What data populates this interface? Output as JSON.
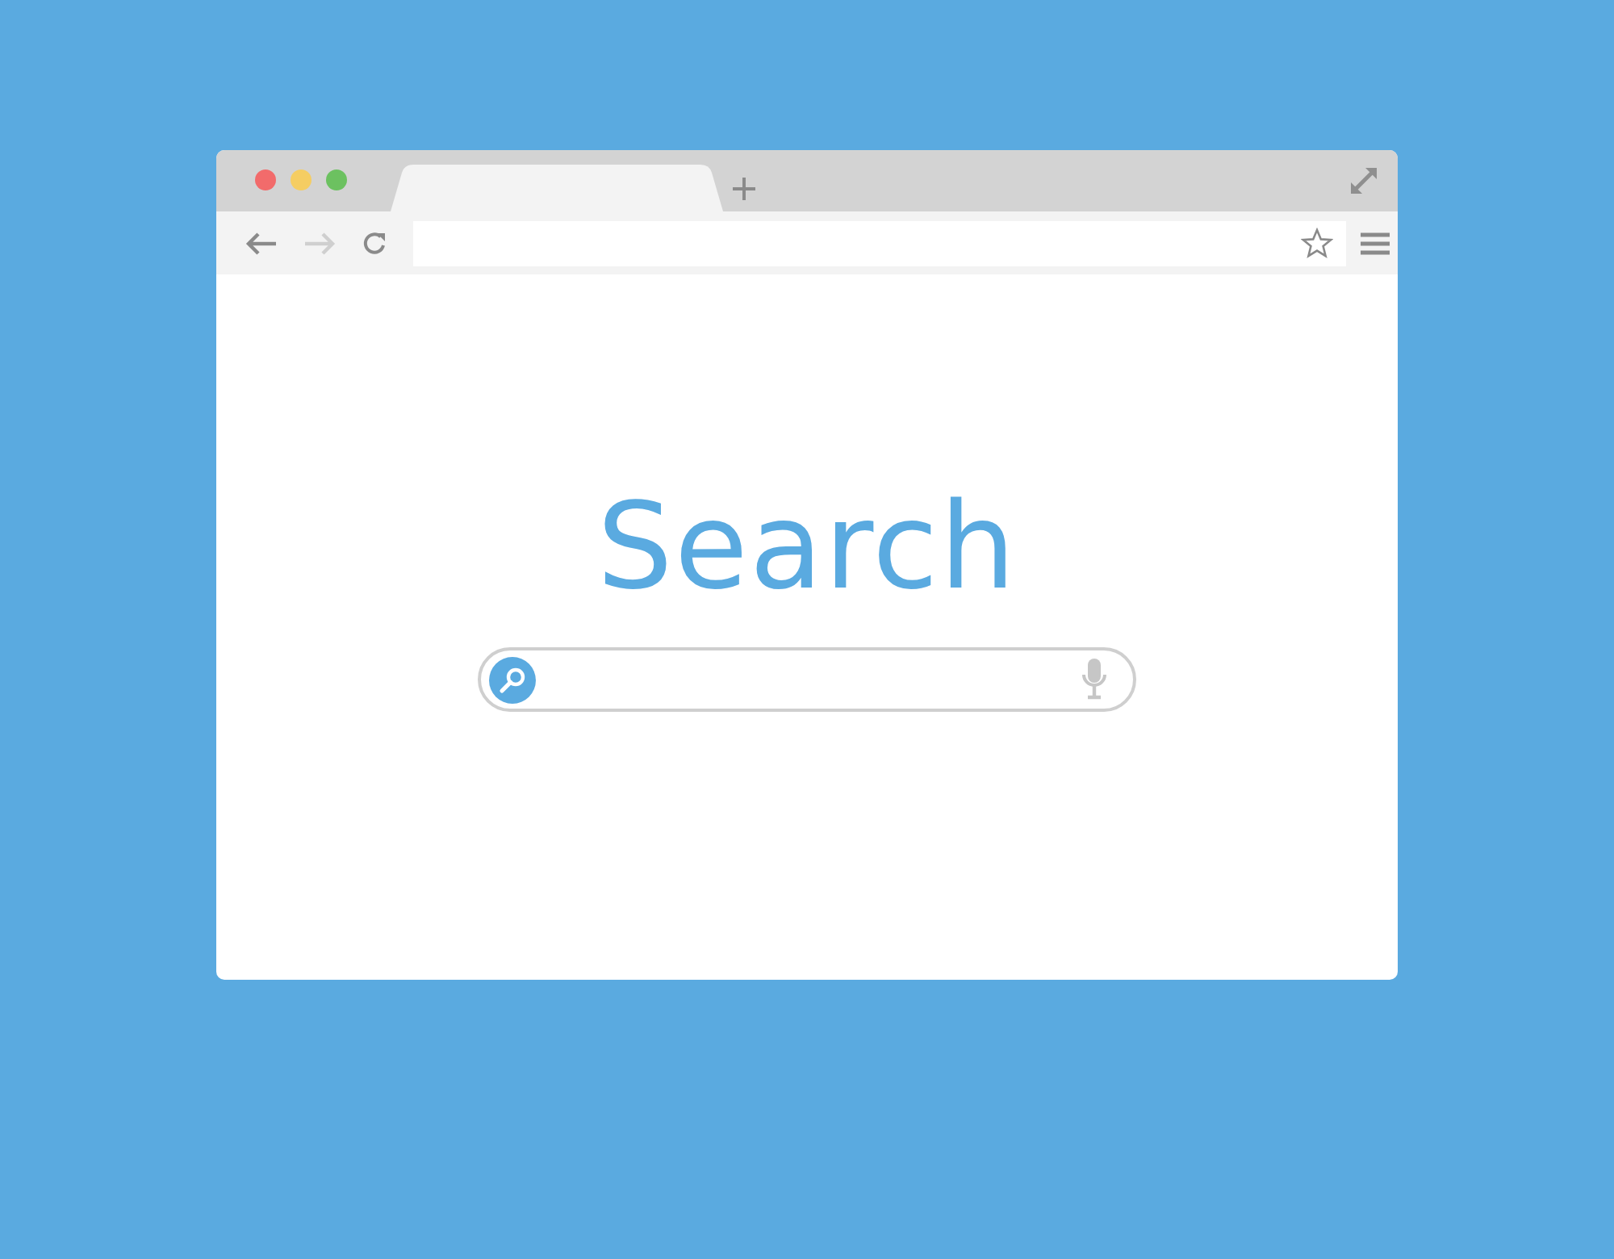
{
  "window": {
    "controls": [
      {
        "color": "#f26b6b"
      },
      {
        "color": "#f5cd62"
      },
      {
        "color": "#6cc160"
      }
    ],
    "tabs": [
      {
        "selected": true
      }
    ]
  },
  "toolbar": {
    "forward_disabled": true
  },
  "page": {
    "heading": "Search"
  }
}
